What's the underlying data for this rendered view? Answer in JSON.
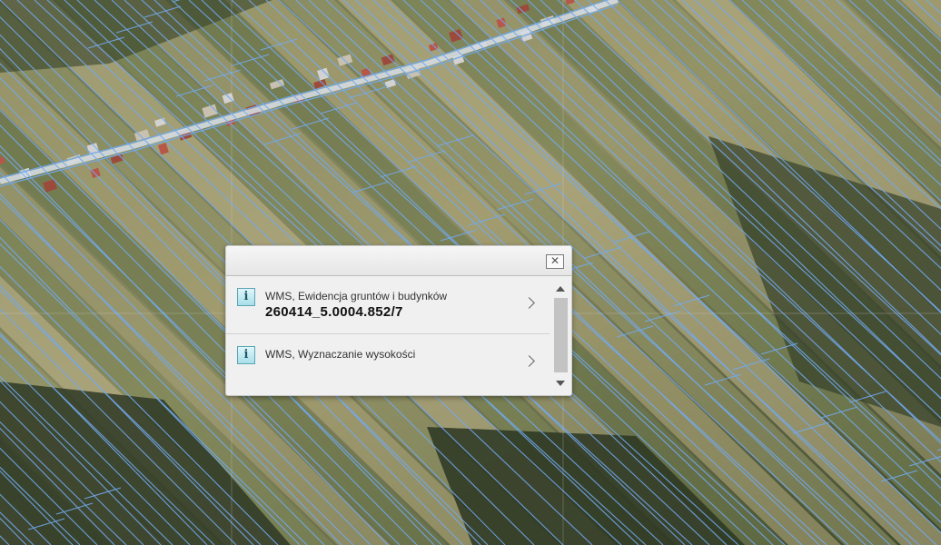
{
  "map": {
    "imagery": "aerial orthophoto with cadastral parcel boundaries",
    "colors": {
      "parcel_line": "#6fa8e6",
      "road": "#c9d2dc",
      "field_light": "#c8b98a",
      "vegetation": "#5c6a3a",
      "forest": "#2f3a24"
    }
  },
  "popup": {
    "close_icon": "close-icon",
    "results": [
      {
        "icon": "info-icon",
        "glyph": "i",
        "title": "WMS, Ewidencja gruntów i budynków",
        "value": "260414_5.0004.852/7"
      },
      {
        "icon": "info-icon",
        "glyph": "i",
        "title": "WMS, Wyznaczanie wysokości",
        "value": ""
      }
    ]
  }
}
